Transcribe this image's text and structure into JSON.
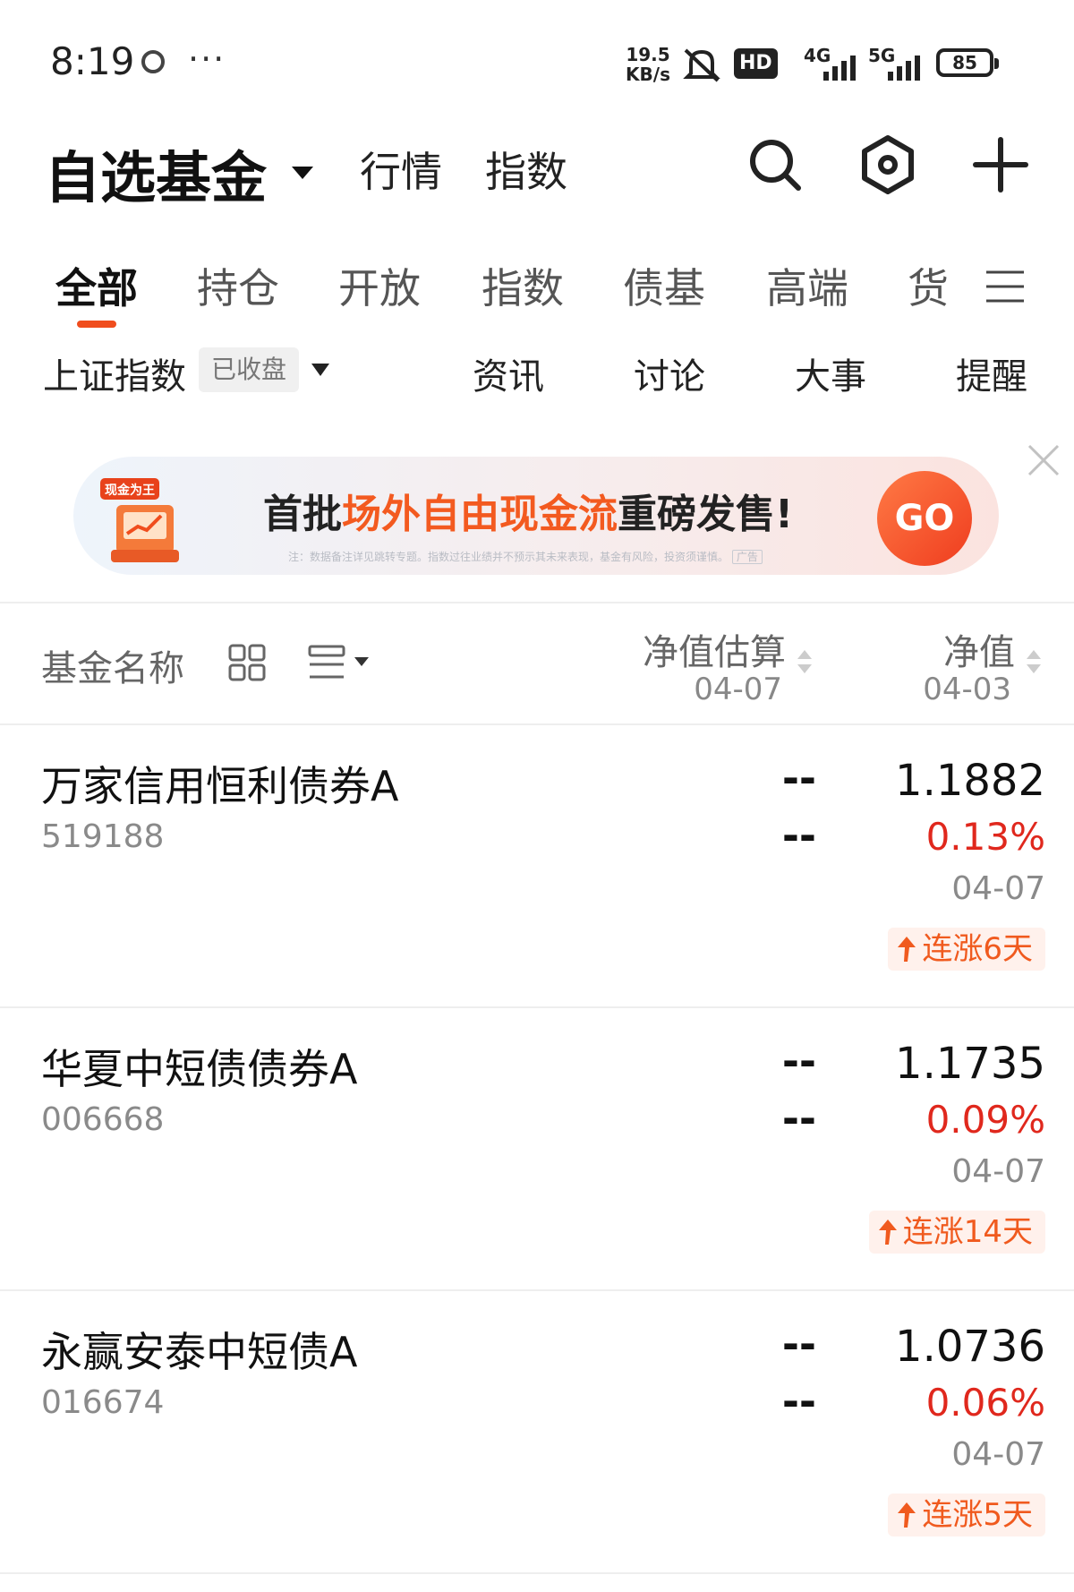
{
  "status_bar": {
    "time": "8:19",
    "more": "···",
    "net_speed_value": "19.5",
    "net_speed_unit": "KB/s",
    "hd_label": "HD",
    "signal1_label": "4G",
    "signal2_label": "5G",
    "battery": "85"
  },
  "header": {
    "title": "自选基金",
    "nav": [
      "行情",
      "指数"
    ],
    "icons": [
      "search-icon",
      "settings-icon",
      "add-icon"
    ]
  },
  "category_tabs": {
    "items": [
      "全部",
      "持仓",
      "开放",
      "指数",
      "债基",
      "高端",
      "货"
    ],
    "active_index": 0,
    "menu_icon": "menu-icon"
  },
  "index_bar": {
    "name": "上证指数",
    "status": "已收盘",
    "links": [
      "资讯",
      "讨论",
      "大事",
      "提醒"
    ]
  },
  "banner": {
    "logo_text": "现金为王",
    "headline_prefix": "首批",
    "headline_highlight": "场外自由现金流",
    "headline_suffix": "重磅发售!",
    "note": "注：数据备注详见跳转专题。指数过往业绩并不预示其未来表现，基金有风险，投资须谨慎。",
    "ad_tag": "广告",
    "cta": "GO",
    "accent_color": "#f35a20"
  },
  "list_header": {
    "name_label": "基金名称",
    "estimate_label": "净值估算",
    "estimate_date": "04-07",
    "nav_label": "净值",
    "nav_date": "04-03"
  },
  "funds": [
    {
      "name": "万家信用恒利债券A",
      "code": "519188",
      "estimate": "--",
      "estimate_change": "--",
      "nav": "1.1882",
      "change": "0.13%",
      "date": "04-07",
      "streak": "连涨6天"
    },
    {
      "name": "华夏中短债债券A",
      "code": "006668",
      "estimate": "--",
      "estimate_change": "--",
      "nav": "1.1735",
      "change": "0.09%",
      "date": "04-07",
      "streak": "连涨14天"
    },
    {
      "name": "永赢安泰中短债A",
      "code": "016674",
      "estimate": "--",
      "estimate_change": "--",
      "nav": "1.0736",
      "change": "0.06%",
      "date": "04-07",
      "streak": "连涨5天"
    }
  ],
  "colors": {
    "up_red": "#e0281d",
    "brand_orange": "#f05a1e"
  }
}
